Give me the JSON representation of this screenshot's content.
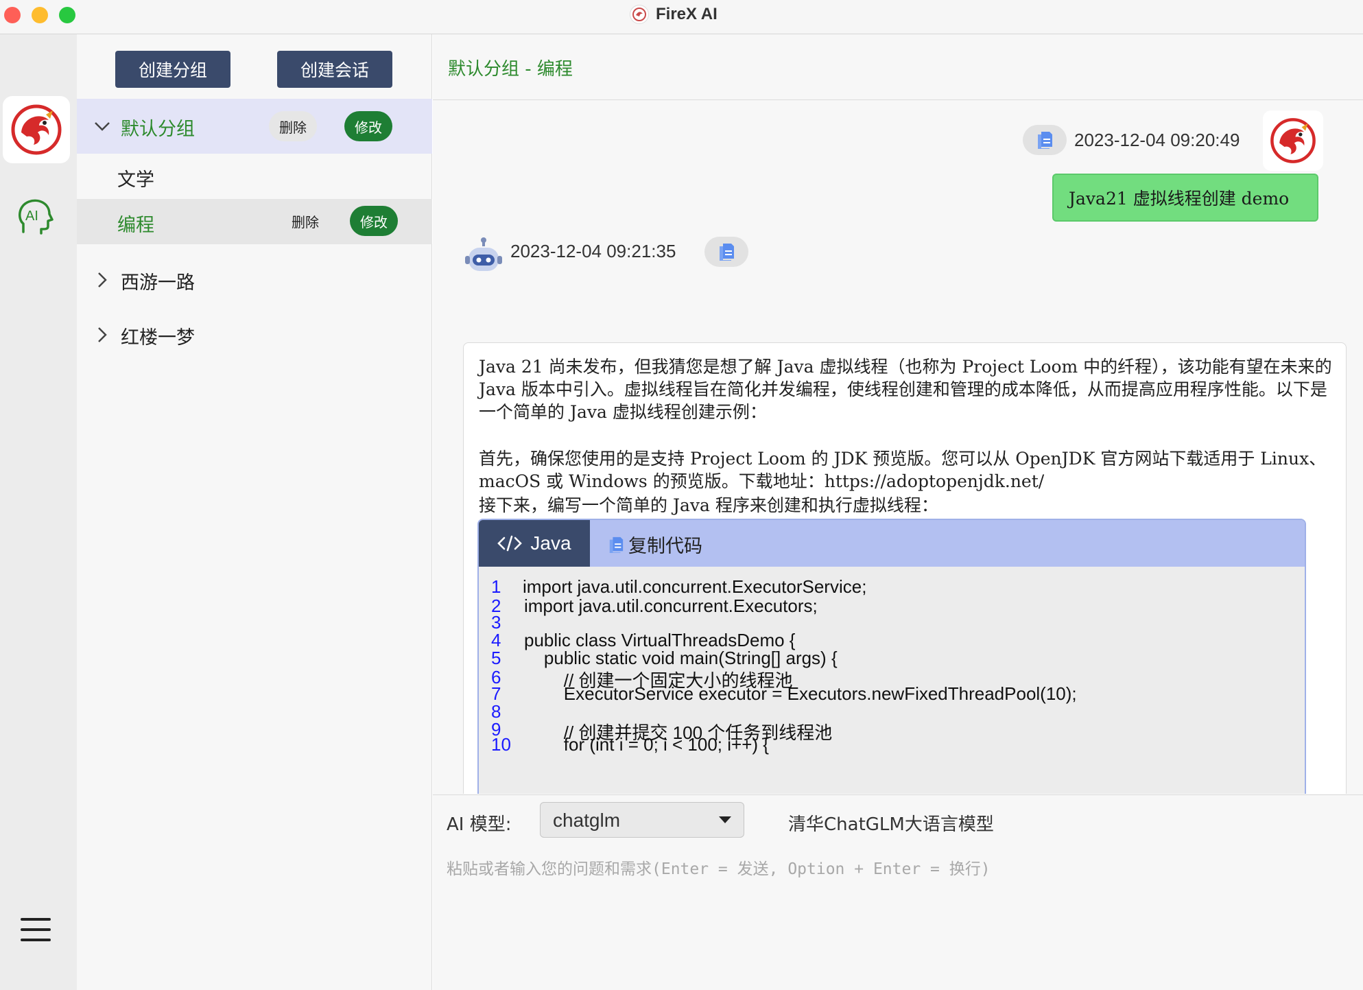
{
  "window": {
    "title": "FireX AI"
  },
  "groups_panel": {
    "create_group_label": "创建分组",
    "create_session_label": "创建会话",
    "groups": [
      {
        "name": "默认分组",
        "expanded": true,
        "delete_label": "删除",
        "edit_label": "修改",
        "sessions": [
          {
            "name": "文学"
          },
          {
            "name": "编程",
            "delete_label": "删除",
            "edit_label": "修改"
          }
        ]
      },
      {
        "name": "西游一路",
        "expanded": false
      },
      {
        "name": "红楼一梦",
        "expanded": false
      }
    ]
  },
  "chat": {
    "title": "默认分组 - 编程",
    "user_message": {
      "timestamp": "2023-12-04 09:20:49",
      "text": "Java21 虚拟线程创建 demo"
    },
    "ai_message": {
      "timestamp": "2023-12-04 09:21:35",
      "paragraphs": [
        "Java 21 尚未发布，但我猜您是想了解 Java 虚拟线程（也称为 Project Loom 中的纤程），该功能有望在未来的 Java 版本中引入。虚拟线程旨在简化并发编程，使线程创建和管理的成本降低，从而提高应用程序性能。以下是一个简单的 Java 虚拟线程创建示例：",
        "首先，确保您使用的是支持 Project Loom 的 JDK 预览版。您可以从 OpenJDK 官方网站下载适用于 Linux、macOS 或 Windows 的预览版。下载地址：https://adoptopenjdk.net/",
        "接下来，编写一个简单的 Java 程序来创建和执行虚拟线程："
      ],
      "code_block": {
        "language": "Java",
        "copy_label": "复制代码",
        "lines": [
          {
            "n": "1",
            "text": "import java.util.concurrent.ExecutorService;"
          },
          {
            "n": "2",
            "text": "import java.util.concurrent.Executors;"
          },
          {
            "n": "3",
            "text": ""
          },
          {
            "n": "4",
            "text": "public class VirtualThreadsDemo {"
          },
          {
            "n": "5",
            "text": "    public static void main(String[] args) {"
          },
          {
            "n": "6",
            "text": "        // 创建一个固定大小的线程池"
          },
          {
            "n": "7",
            "text": "        ExecutorService executor = Executors.newFixedThreadPool(10);"
          },
          {
            "n": "8",
            "text": ""
          },
          {
            "n": "9",
            "text": "        // 创建并提交 100 个任务到线程池"
          },
          {
            "n": "10",
            "text": "        for (int i = 0; i < 100; i++) {"
          }
        ]
      }
    }
  },
  "input": {
    "model_label": "AI 模型:",
    "model_value": "chatglm",
    "model_description": "清华ChatGLM大语言模型",
    "placeholder": "粘贴或者输入您的问题和需求(Enter = 发送, Option + Enter = 换行)"
  },
  "colors": {
    "accent_green": "#1e7e34",
    "user_bubble": "#72dd7f",
    "button_navy": "#3a4a6b",
    "code_header": "#b3c0f1"
  }
}
